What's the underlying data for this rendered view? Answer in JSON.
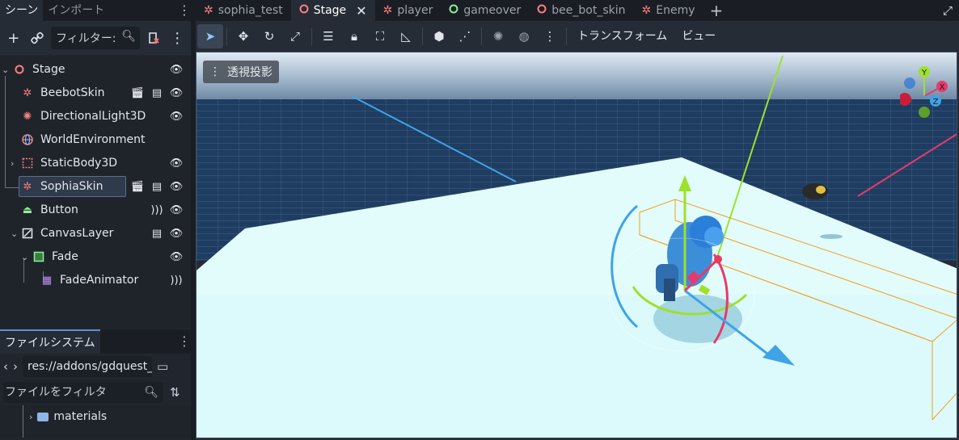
{
  "left_dock": {
    "tabs": [
      "シーン",
      "インポート"
    ],
    "filter_placeholder": "フィルター:"
  },
  "scene_tree": [
    {
      "name": "Stage",
      "icon": "node3d-icon",
      "icon_color": "#fc7f7f",
      "visible": true
    },
    {
      "name": "BeebotSkin",
      "icon": "skeleton-icon",
      "icon_color": "#fc7f7f",
      "badges": [
        "clapper-icon",
        "script-icon"
      ],
      "visible": true
    },
    {
      "name": "DirectionalLight3D",
      "icon": "light-icon",
      "icon_color": "#fc7f7f",
      "visible": true
    },
    {
      "name": "WorldEnvironment",
      "icon": "globe-icon",
      "icon_color": "#fc7f7f"
    },
    {
      "name": "StaticBody3D",
      "icon": "body-icon",
      "icon_color": "#fc7f7f",
      "visible": true
    },
    {
      "name": "SophiaSkin",
      "icon": "skeleton-icon",
      "icon_color": "#fc7f7f",
      "badges": [
        "clapper-icon",
        "script-icon"
      ],
      "visible": true,
      "selected": true
    },
    {
      "name": "Button",
      "icon": "button-icon",
      "icon_color": "#8eef97",
      "badges": [
        "signal-icon"
      ],
      "visible": true
    },
    {
      "name": "CanvasLayer",
      "icon": "canvas-layer-icon",
      "icon_color": "#e6e9ee",
      "badges": [
        "script-icon"
      ],
      "visible": true
    },
    {
      "name": "Fade",
      "icon": "color-rect-icon",
      "icon_color": "#8eef97",
      "visible": true
    },
    {
      "name": "FadeAnimator",
      "icon": "animation-player-icon",
      "icon_color": "#c38ef1",
      "badges": [
        "signal-icon"
      ]
    }
  ],
  "filesystem": {
    "tab": "ファイルシステム",
    "path": "res://addons/gdquest_",
    "filter_placeholder": "ファイルをフィルタ",
    "items": [
      {
        "name": "materials"
      }
    ]
  },
  "scene_tabs": [
    {
      "label": "sophia_test",
      "icon": "skeleton-icon",
      "color": "#fc7f7f"
    },
    {
      "label": "Stage",
      "icon": "node3d-icon",
      "color": "#fc7f7f",
      "active": true
    },
    {
      "label": "player",
      "icon": "skeleton-icon",
      "color": "#fc7f7f"
    },
    {
      "label": "gameover",
      "icon": "control-icon",
      "color": "#8eef97"
    },
    {
      "label": "bee_bot_skin",
      "icon": "node3d-icon",
      "color": "#fc7f7f"
    },
    {
      "label": "Enemy",
      "icon": "skeleton-icon",
      "color": "#fc7f7f"
    }
  ],
  "viewport_toolbar": {
    "transform_menu": "トランスフォーム",
    "view_menu": "ビュー"
  },
  "viewport": {
    "perspective_label": "透視投影",
    "gizmo_axes": {
      "x": "X",
      "y": "Y",
      "z": "Z"
    }
  }
}
